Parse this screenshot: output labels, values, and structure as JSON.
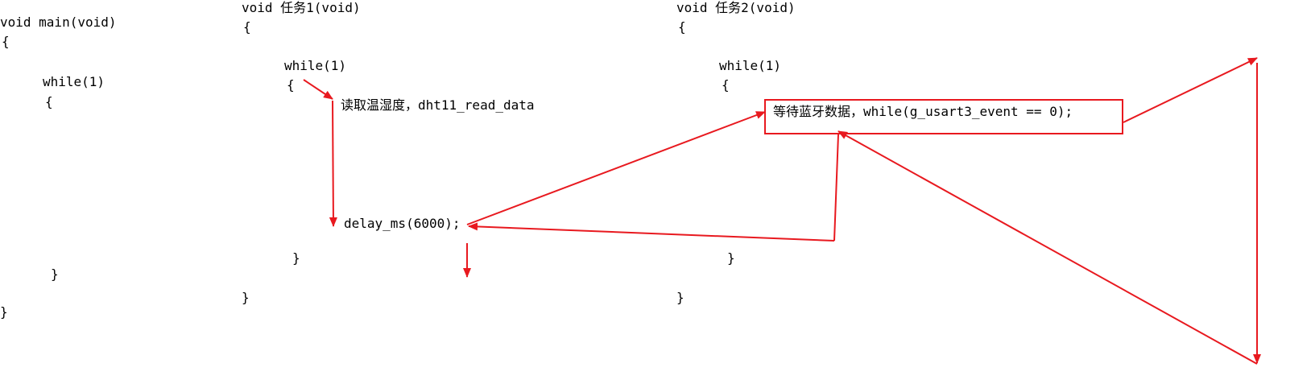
{
  "main_func": {
    "signature": "void main(void)",
    "open_brace": "{",
    "while_stmt": "while(1)",
    "while_open": "{",
    "while_close": "}",
    "close_brace": "}"
  },
  "task1": {
    "signature": "void 任务1(void)",
    "open_brace": "{",
    "while_stmt": "while(1)",
    "while_open": "{",
    "read_stmt": "读取温湿度，dht11_read_data",
    "delay_stmt": "delay_ms(6000);",
    "while_close": "}",
    "close_brace": "}"
  },
  "task2": {
    "signature": "void 任务2(void)",
    "open_brace": "{",
    "while_stmt": "while(1)",
    "while_open": "{",
    "wait_stmt": "等待蓝牙数据，while(g_usart3_event == 0);",
    "while_close": "}",
    "close_brace": "}"
  },
  "colors": {
    "arrow": "#e8191f",
    "text": "#000000",
    "background": "#ffffff"
  }
}
